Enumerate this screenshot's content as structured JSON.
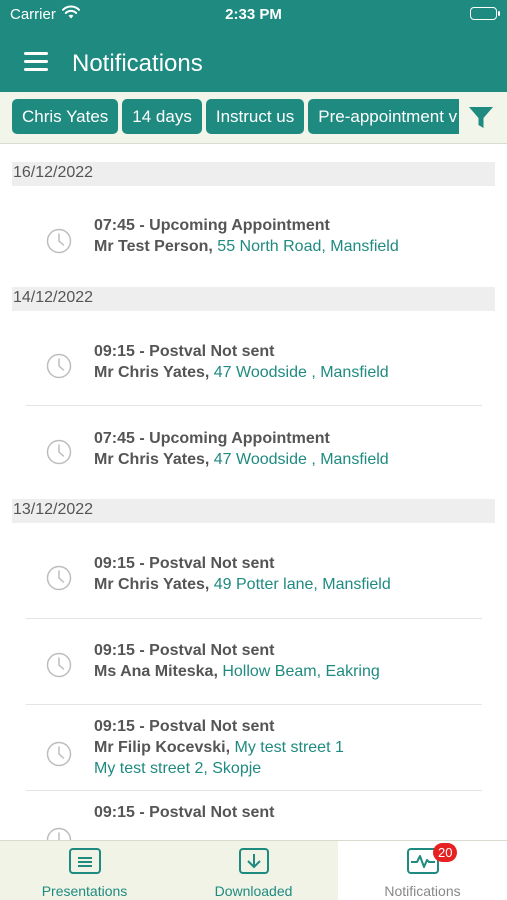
{
  "status_bar": {
    "carrier": "Carrier",
    "time": "2:33 PM",
    "wifi_icon": "wifi-icon",
    "battery_icon": "battery-icon"
  },
  "nav": {
    "title": "Notifications",
    "menu_icon": "hamburger-menu-icon"
  },
  "filters": {
    "chips": [
      "Chris Yates",
      "14 days",
      "Instruct us",
      "Pre-appointment v"
    ],
    "filter_icon": "funnel-icon"
  },
  "groups": [
    {
      "date": "16/12/2022",
      "items": [
        {
          "title": "07:45 - Upcoming Appointment",
          "person": "Mr Test Person,",
          "address": "55 North Road, Mansfield"
        }
      ]
    },
    {
      "date": "14/12/2022",
      "items": [
        {
          "title": "09:15 - Postval Not sent",
          "person": "Mr Chris Yates,",
          "address": "47 Woodside , Mansfield"
        },
        {
          "title": "07:45 - Upcoming Appointment",
          "person": "Mr Chris Yates,",
          "address": "47 Woodside , Mansfield"
        }
      ]
    },
    {
      "date": "13/12/2022",
      "items": [
        {
          "title": "09:15 - Postval Not sent",
          "person": "Mr Chris Yates,",
          "address": "49 Potter lane, Mansfield"
        },
        {
          "title": "09:15 - Postval Not sent",
          "person": "Ms Ana Miteska,",
          "address": "Hollow Beam, Eakring"
        },
        {
          "title": "09:15 - Postval Not sent",
          "person": "Mr Filip Kocevski,",
          "address": "My test street 1",
          "address_line2": "My test street 2, Skopje"
        },
        {
          "title": "09:15 - Postval Not sent",
          "person": "",
          "address": ""
        }
      ]
    }
  ],
  "tabs": [
    {
      "label": "Presentations",
      "icon": "presentation-icon",
      "selected": false
    },
    {
      "label": "Downloaded",
      "icon": "download-icon",
      "selected": false
    },
    {
      "label": "Notifications",
      "icon": "activity-icon",
      "selected": true,
      "badge": "20"
    }
  ],
  "colors": {
    "brand": "#1f8a80",
    "badge": "#e62121",
    "tab_bar_bg": "#f0f3e6",
    "date_header_bg": "#eeeeee"
  }
}
